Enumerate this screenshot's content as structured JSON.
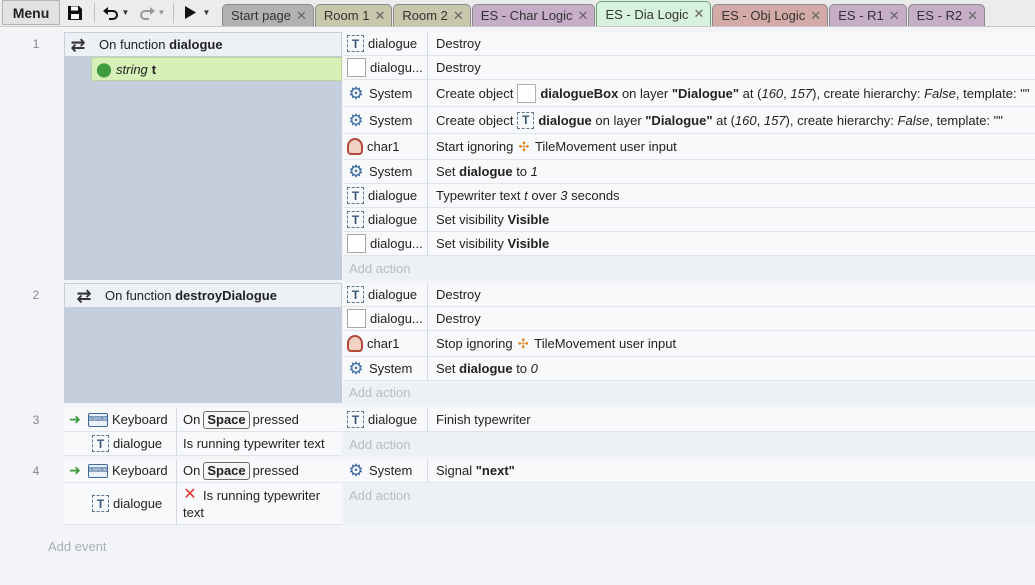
{
  "toolbar": {
    "menu_label": "Menu",
    "save_icon": "save-icon",
    "undo_icon": "undo-icon",
    "redo_icon": "redo-icon",
    "play_icon": "play-icon"
  },
  "tabs": [
    {
      "label": "Start page",
      "color": "#b1b1b1"
    },
    {
      "label": "Room 1",
      "color": "#c7c7ab"
    },
    {
      "label": "Room 2",
      "color": "#c7c7ab"
    },
    {
      "label": "ES - Char Logic",
      "color": "#c6adc8"
    },
    {
      "label": "ES - Dia Logic",
      "color": "#d7f2dd"
    },
    {
      "label": "ES - Obj Logic",
      "color": "#d3aaa7"
    },
    {
      "label": "ES - R1",
      "color": "#c6adc8"
    },
    {
      "label": "ES - R2",
      "color": "#c6adc8"
    }
  ],
  "events": {
    "e1": {
      "number": "1",
      "head_prefix": "On function ",
      "head_name": "dialogue",
      "param_type": "string",
      "param_name": "t",
      "actions": [
        {
          "obj": "dialogue",
          "text": "Destroy"
        },
        {
          "obj": "dialogu...",
          "text": "Destroy"
        },
        {
          "obj": "System",
          "a": "Create object ",
          "b": "dialogueBox",
          "c": " on layer ",
          "d": "\"Dialogue\"",
          "e": " at (",
          "f": "160",
          "g": ", ",
          "h": "157",
          "i": "), create hierarchy: ",
          "j": "False",
          "k": ", template: \"\""
        },
        {
          "obj": "System",
          "a": "Create object ",
          "b": "dialogue",
          "c": " on layer ",
          "d": "\"Dialogue\"",
          "e": " at (",
          "f": "160",
          "g": ", ",
          "h": "157",
          "i": "), create hierarchy: ",
          "j": "False",
          "k": ", template: \"\""
        },
        {
          "obj": "char1",
          "a": "Start ignoring ",
          "b": "TileMovement user input"
        },
        {
          "obj": "System",
          "a": "Set ",
          "b": "dialogue",
          "c": " to ",
          "d": "1"
        },
        {
          "obj": "dialogue",
          "a": "Typewriter text ",
          "b": "t",
          "c": " over ",
          "d": "3",
          "e": " seconds"
        },
        {
          "obj": "dialogue",
          "a": "Set visibility ",
          "b": "Visible"
        },
        {
          "obj": "dialogu...",
          "a": "Set visibility ",
          "b": "Visible"
        }
      ],
      "add_action": "Add action"
    },
    "e2": {
      "number": "2",
      "head_prefix": "On function ",
      "head_name": "destroyDialogue",
      "actions": [
        {
          "obj": "dialogue",
          "text": "Destroy"
        },
        {
          "obj": "dialogu...",
          "text": "Destroy"
        },
        {
          "obj": "char1",
          "a": "Stop ignoring ",
          "b": "TileMovement user input"
        },
        {
          "obj": "System",
          "a": "Set ",
          "b": "dialogue",
          "c": " to ",
          "d": "0"
        }
      ],
      "add_action": "Add action"
    },
    "e3": {
      "number": "3",
      "conds": [
        {
          "obj": "Keyboard",
          "a": "On",
          "key": "Space",
          "b": "pressed"
        },
        {
          "obj": "dialogue",
          "text": "Is running typewriter text"
        }
      ],
      "actions": [
        {
          "obj": "dialogue",
          "text": "Finish typewriter"
        }
      ],
      "add_action": "Add action"
    },
    "e4": {
      "number": "4",
      "conds": [
        {
          "obj": "Keyboard",
          "a": "On",
          "key": "Space",
          "b": "pressed"
        },
        {
          "obj": "dialogue",
          "line1": "Is running typewriter",
          "line2": "text"
        }
      ],
      "actions": [
        {
          "obj": "System",
          "a": "Signal ",
          "b": "\"next\""
        }
      ],
      "add_action": "Add action"
    }
  },
  "add_event": "Add event"
}
